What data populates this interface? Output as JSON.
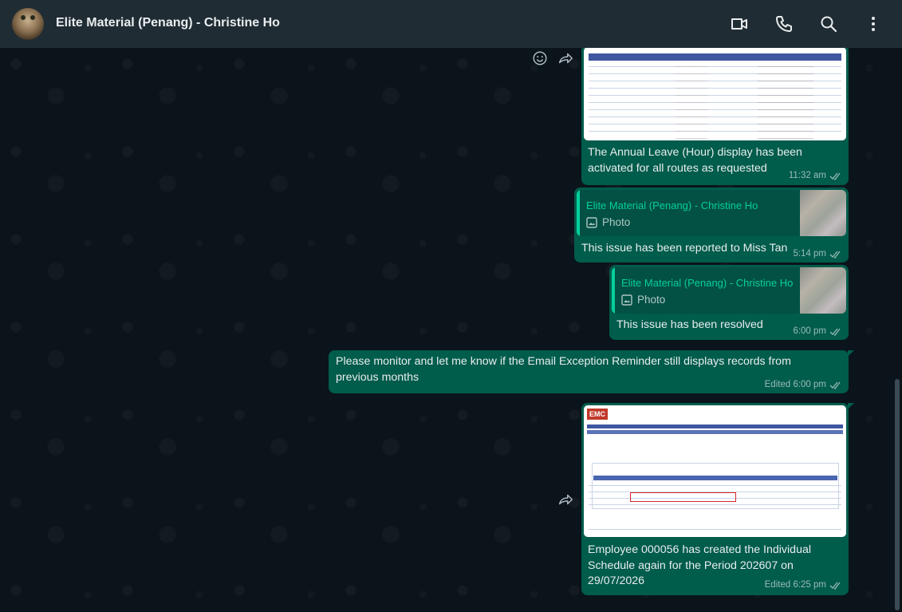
{
  "header": {
    "title": "Elite Material (Penang) - Christine Ho",
    "icons": [
      "video-call-icon",
      "voice-call-icon",
      "search-icon",
      "menu-icon"
    ]
  },
  "messages": [
    {
      "type": "image",
      "caption": "The Annual Leave (Hour) display has been activated for all routes as requested",
      "time": "11:32 am"
    },
    {
      "type": "reply",
      "quoted_name": "Elite Material (Penang) - Christine Ho",
      "quoted_type": "Photo",
      "text": "This issue has been reported to Miss Tan",
      "time": "5:14 pm"
    },
    {
      "type": "reply",
      "quoted_name": "Elite Material (Penang) - Christine Ho",
      "quoted_type": "Photo",
      "text": "This issue has been resolved",
      "time": "6:00 pm"
    },
    {
      "type": "text",
      "text": "Please monitor and let me know if the Email Exception Reminder still displays records from previous months",
      "time": "Edited 6:00 pm"
    },
    {
      "type": "image",
      "caption": "Employee 000056 has created the Individual Schedule again for the Period 202607 on 29/07/2026",
      "time": "Edited 6:25 pm"
    }
  ],
  "colors": {
    "outgoing_bubble": "#005c4b",
    "header_bg": "#202c33",
    "chat_bg": "#0b141a",
    "accent": "#06cf9c"
  }
}
